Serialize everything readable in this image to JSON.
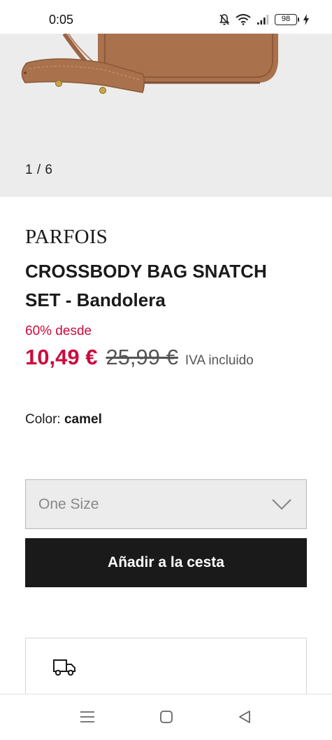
{
  "status_bar": {
    "time": "0:05",
    "battery": "98",
    "icons": [
      "mute-icon",
      "wifi-icon",
      "signal-icon",
      "battery-icon",
      "charging-icon"
    ]
  },
  "gallery": {
    "counter": "1 / 6",
    "image_description": "camel crossbody bag"
  },
  "product": {
    "brand": "PARFOIS",
    "title": "CROSSBODY BAG SNATCH SET - Bandolera",
    "discount_label": "60% desde",
    "price_now": "10,49 €",
    "price_old": "25,99 €",
    "vat_label": "IVA incluido"
  },
  "color": {
    "label": "Color:",
    "value": "camel"
  },
  "size_select": {
    "value": "One Size"
  },
  "add_to_cart": {
    "label": "Añadir a la cesta"
  },
  "delivery": {
    "icon": "truck-icon"
  },
  "nav": {
    "items": [
      "menu-icon",
      "home-icon",
      "back-icon"
    ]
  },
  "colors": {
    "sale_red": "#cc0a3d",
    "button_black": "#1a1a1a",
    "hero_bg": "#ececec",
    "bag_brown": "#a9714c"
  }
}
